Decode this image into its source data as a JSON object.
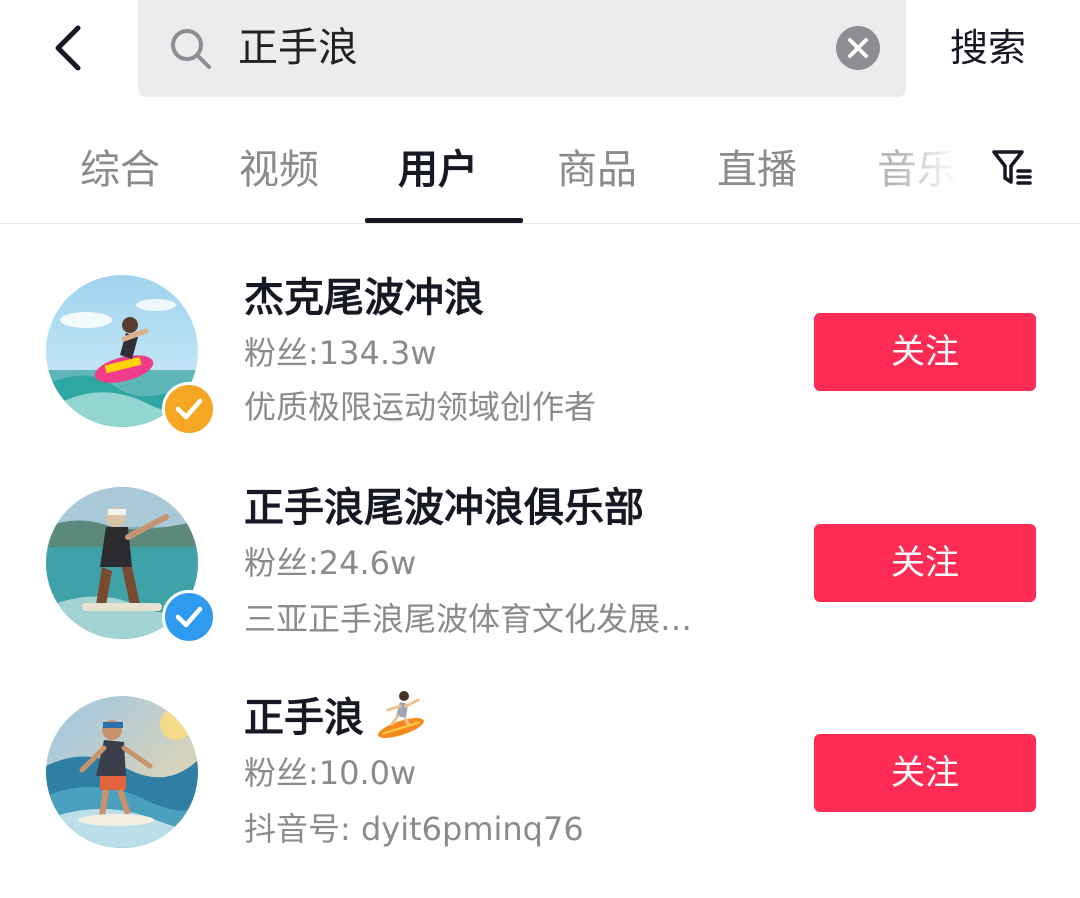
{
  "search": {
    "query": "正手浪",
    "submit_label": "搜索"
  },
  "tabs": [
    {
      "label": "综合",
      "active": false
    },
    {
      "label": "视频",
      "active": false
    },
    {
      "label": "用户",
      "active": true
    },
    {
      "label": "商品",
      "active": false
    },
    {
      "label": "直播",
      "active": false
    },
    {
      "label": "音乐",
      "active": false
    }
  ],
  "users": [
    {
      "name": "杰克尾波冲浪",
      "fans": "粉丝:134.3w",
      "desc": "优质极限运动领域创作者",
      "badge": "orange-verified-check",
      "follow_label": "关注"
    },
    {
      "name": "正手浪尾波冲浪俱乐部",
      "fans": "粉丝:24.6w",
      "desc": "三亚正手浪尾波体育文化发展…",
      "badge": "blue-verified-check",
      "follow_label": "关注"
    },
    {
      "name": "正手浪",
      "name_icon": "surfer-emoji",
      "fans": "粉丝:10.0w",
      "desc": "抖音号: dyit6pminq76",
      "follow_label": "关注"
    }
  ],
  "colors": {
    "accent": "#fe2c55",
    "badge_orange": "#f5a623",
    "badge_blue": "#2e9bf0",
    "search_bg": "#ececee",
    "muted_text": "#8a8a8f"
  }
}
